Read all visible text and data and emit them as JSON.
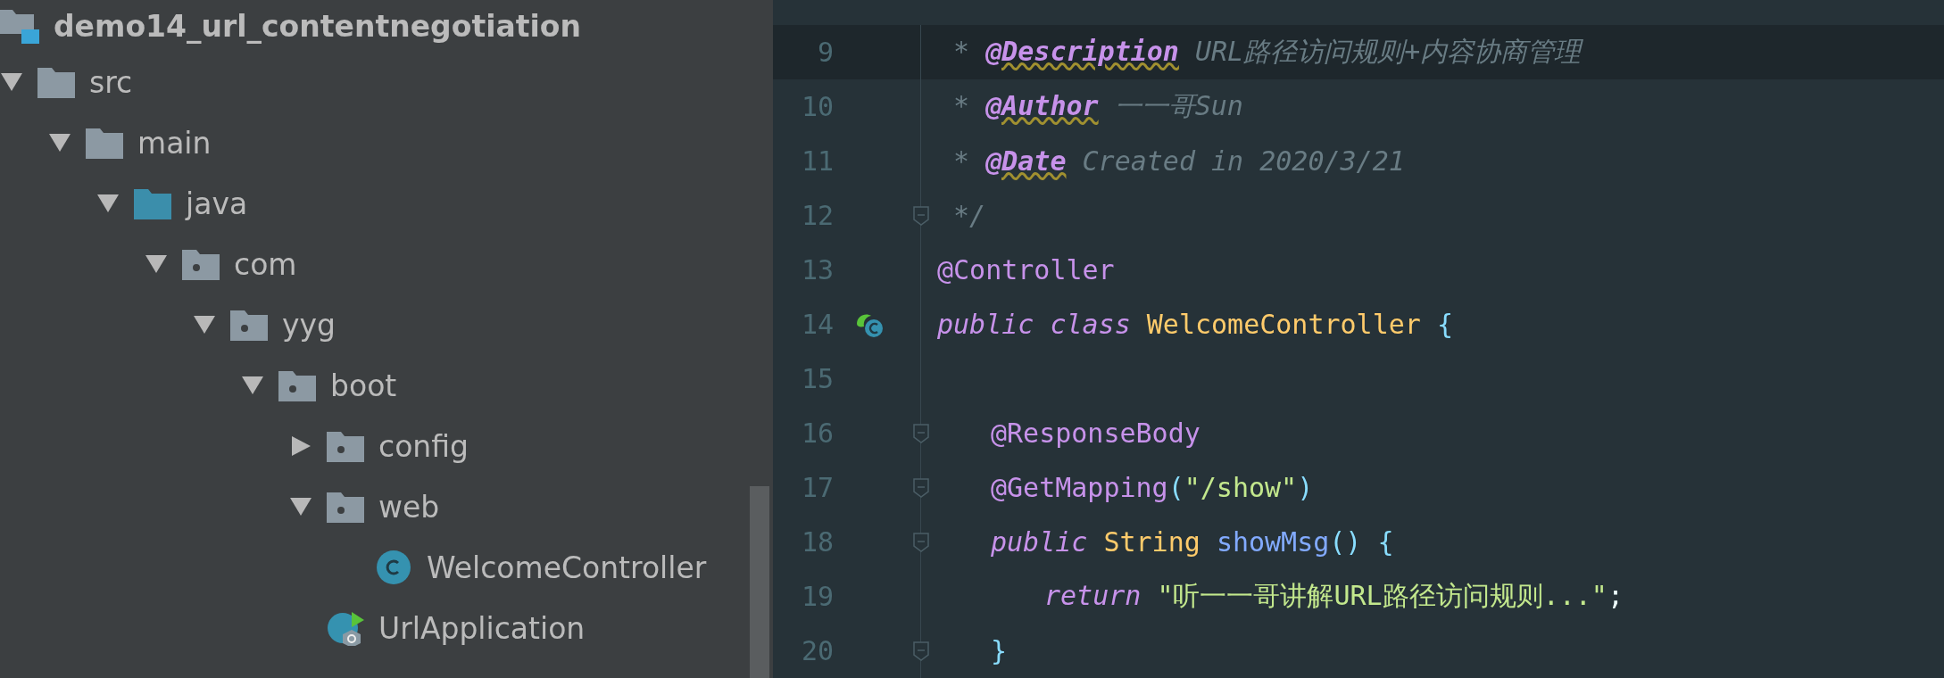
{
  "project_tree": {
    "root": {
      "label": "demo14_url_contentnegotiation",
      "kind": "project",
      "children": [
        {
          "label": "src",
          "kind": "folder",
          "expanded": true,
          "children": [
            {
              "label": "main",
              "kind": "folder",
              "expanded": true,
              "children": [
                {
                  "label": "java",
                  "kind": "source",
                  "expanded": true,
                  "children": [
                    {
                      "label": "com",
                      "kind": "package",
                      "expanded": true,
                      "children": [
                        {
                          "label": "yyg",
                          "kind": "package",
                          "expanded": true,
                          "children": [
                            {
                              "label": "boot",
                              "kind": "package",
                              "expanded": true,
                              "children": [
                                {
                                  "label": "config",
                                  "kind": "package",
                                  "expanded": false
                                },
                                {
                                  "label": "web",
                                  "kind": "package",
                                  "expanded": true,
                                  "children": [
                                    {
                                      "label": "WelcomeController",
                                      "kind": "class"
                                    }
                                  ]
                                },
                                {
                                  "label": "UrlApplication",
                                  "kind": "app"
                                }
                              ]
                            }
                          ]
                        }
                      ]
                    }
                  ]
                }
              ]
            }
          ]
        }
      ]
    }
  },
  "editor": {
    "lines": [
      {
        "number": "9",
        "current": true,
        "fold": false,
        "tokens": [
          {
            "kind": "comment",
            "text": " * "
          },
          {
            "kind": "tag",
            "text": "@Description"
          },
          {
            "kind": "comment",
            "text": " URL路径访问规则+内容协商管理"
          }
        ]
      },
      {
        "number": "10",
        "current": false,
        "fold": false,
        "tokens": [
          {
            "kind": "comment",
            "text": " * "
          },
          {
            "kind": "tag",
            "text": "@Author"
          },
          {
            "kind": "comment",
            "text": " 一一哥Sun"
          }
        ]
      },
      {
        "number": "11",
        "current": false,
        "fold": false,
        "tokens": [
          {
            "kind": "comment",
            "text": " * "
          },
          {
            "kind": "tag",
            "text": "@Date"
          },
          {
            "kind": "comment",
            "text": " Created in 2020/3/21"
          }
        ]
      },
      {
        "number": "12",
        "current": false,
        "fold": true,
        "tokens": [
          {
            "kind": "comment",
            "text": " */"
          }
        ]
      },
      {
        "number": "13",
        "current": false,
        "fold": false,
        "tokens": [
          {
            "kind": "annotation",
            "text": "@Controller"
          }
        ]
      },
      {
        "number": "14",
        "current": false,
        "fold": false,
        "bean_marker": true,
        "tokens": [
          {
            "kind": "keyword",
            "text": "public class "
          },
          {
            "kind": "type",
            "text": "WelcomeController"
          },
          {
            "kind": "brace",
            "text": " {"
          }
        ],
        "children": [
          {
            "number": "15",
            "current": false,
            "fold": false
          },
          {
            "number": "16",
            "current": false,
            "fold": true,
            "tokens": [
              {
                "kind": "annotation",
                "text": "@ResponseBody"
              }
            ]
          },
          {
            "number": "17",
            "current": false,
            "fold": true,
            "tokens": [
              {
                "kind": "annotation",
                "text": "@GetMapping"
              },
              {
                "kind": "brace",
                "text": "("
              },
              {
                "kind": "string",
                "text": "\"/show\""
              },
              {
                "kind": "brace",
                "text": ")"
              }
            ]
          },
          {
            "number": "18",
            "current": false,
            "fold": true,
            "tokens": [
              {
                "kind": "keyword",
                "text": "public "
              },
              {
                "kind": "type",
                "text": "String "
              },
              {
                "kind": "method",
                "text": "showMsg"
              },
              {
                "kind": "brace",
                "text": "() {"
              }
            ],
            "children": [
              {
                "number": "19",
                "current": false,
                "fold": false,
                "tokens": [
                  {
                    "kind": "keyword",
                    "text": "return "
                  },
                  {
                    "kind": "string",
                    "text": "\"听一一哥讲解URL路径访问规则...\""
                  },
                  {
                    "kind": "plain",
                    "text": ";"
                  }
                ]
              }
            ]
          },
          {
            "number": "20",
            "current": false,
            "fold": true,
            "tokens": [
              {
                "kind": "brace",
                "text": "}"
              }
            ]
          }
        ]
      }
    ]
  }
}
